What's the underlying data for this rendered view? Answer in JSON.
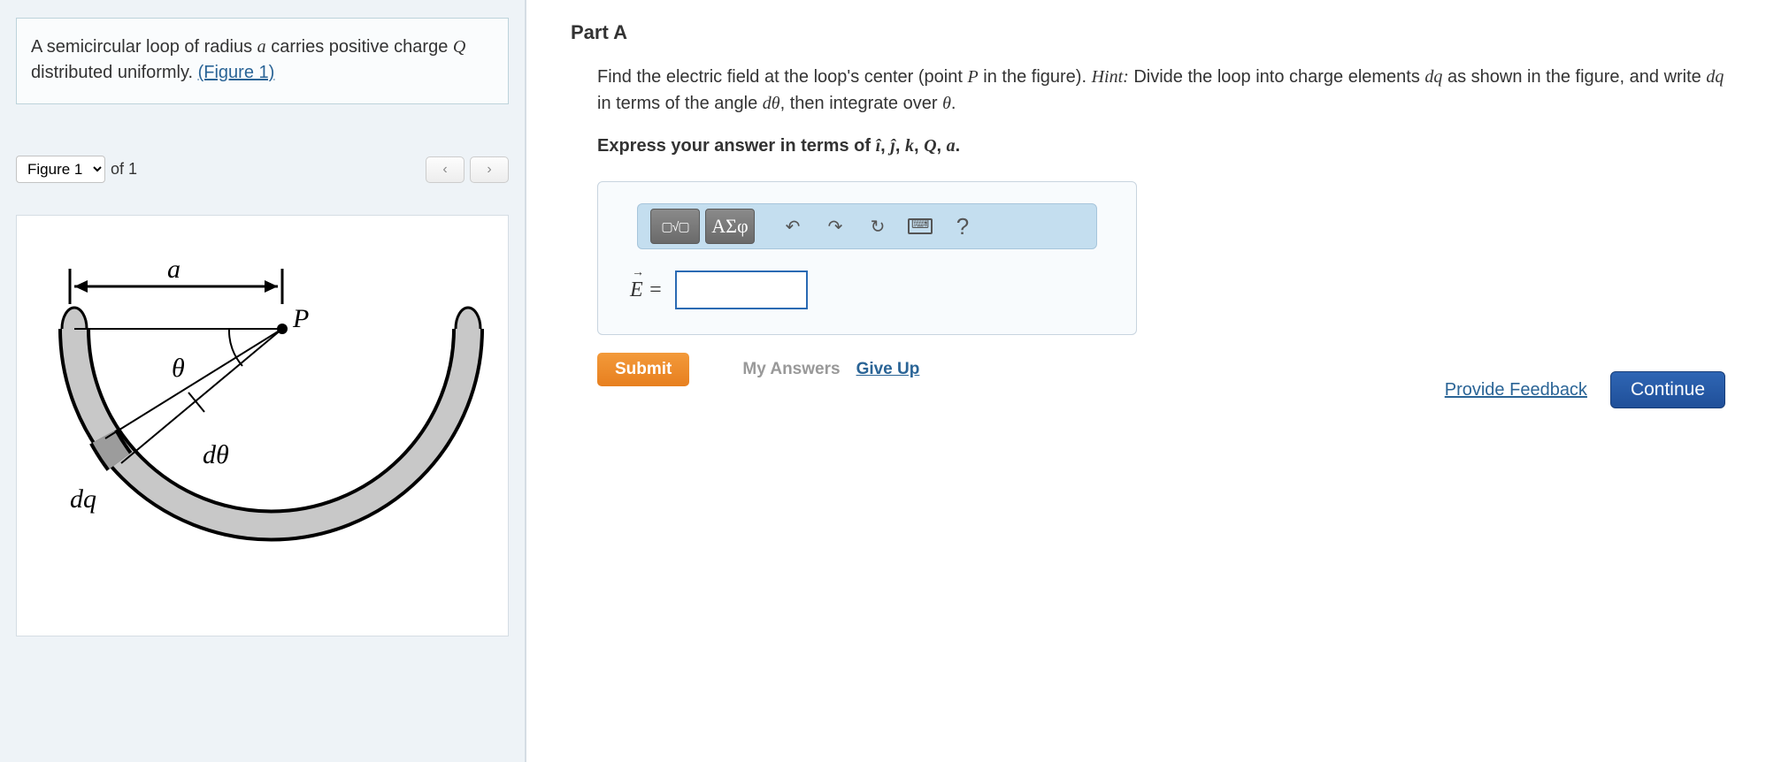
{
  "left": {
    "problem_html": "A semicircular loop of radius <span class='ital'>a</span> carries positive charge <span class='ital'>Q</span> distributed uniformly.",
    "figure_link_text": "(Figure 1)",
    "figure_selector": {
      "option": "Figure 1",
      "of_text": "of 1"
    },
    "nav_prev": "‹",
    "nav_next": "›",
    "diagram": {
      "a_label": "a",
      "p_label": "P",
      "theta_label": "θ",
      "dtheta_label": "dθ",
      "dq_label": "dq"
    }
  },
  "right": {
    "part_title": "Part A",
    "question": "Find the electric field at the loop's center (point <span class='ital'>P</span> in the figure). <span class='ital'>Hint:</span> Divide the loop into charge elements <span class='ital'>dq</span> as shown in the figure, and write <span class='ital'>dq</span> in terms of the angle <span class='ital'>dθ</span>, then integrate over <span class='ital'>θ</span>.",
    "express": "Express your answer in terms of <span class='ital'>î</span>, <span class='ital'>ĵ</span>, <span class='ital'>k</span>, <span class='ital'>Q</span>, <span class='ital'>a</span>.",
    "toolbar": {
      "templates": "▢√▢",
      "greek": "ΑΣφ",
      "undo": "↶",
      "redo": "↷",
      "reset": "↻",
      "keyboard": "kbd",
      "help": "?"
    },
    "e_label": "E",
    "equals": " = ",
    "submit": "Submit",
    "my_answers": "My Answers",
    "give_up": "Give Up",
    "feedback": "Provide Feedback",
    "continue": "Continue"
  }
}
